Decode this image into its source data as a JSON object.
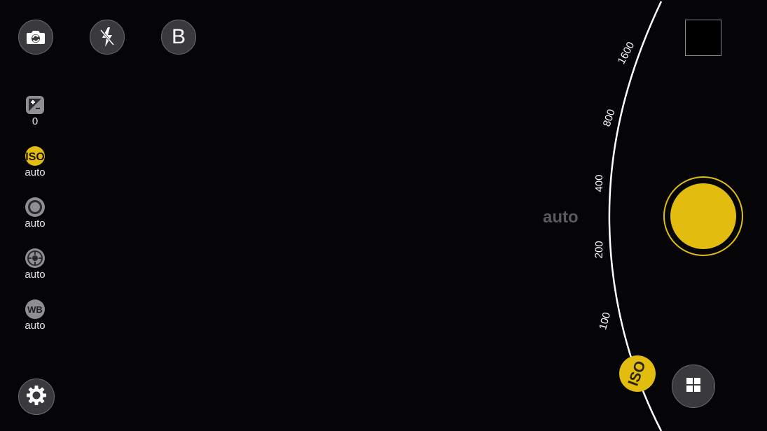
{
  "top_bar": {
    "switch_camera_icon": "camera-switch-icon",
    "flash_icon": "flash-off-icon",
    "beauty_label": "B"
  },
  "settings": {
    "exposure": {
      "icon": "exposure-icon",
      "value": "0"
    },
    "iso": {
      "icon": "iso-icon",
      "value": "auto",
      "active": true
    },
    "focus": {
      "icon": "focus-icon",
      "value": "auto"
    },
    "metering": {
      "icon": "metering-icon",
      "value": "auto"
    },
    "white_balance": {
      "icon": "wb-icon",
      "icon_text": "WB",
      "value": "auto"
    },
    "iso_icon_text": "ISO"
  },
  "dial": {
    "current_value": "auto",
    "ticks": [
      "100",
      "200",
      "400",
      "800",
      "1600"
    ],
    "knob_label": "ISO"
  },
  "colors": {
    "accent": "#e2bd10",
    "button_bg": "#3a393d",
    "background": "#050407"
  },
  "bottom": {
    "settings_icon": "gear-icon",
    "mode_icon": "grid-icon"
  }
}
